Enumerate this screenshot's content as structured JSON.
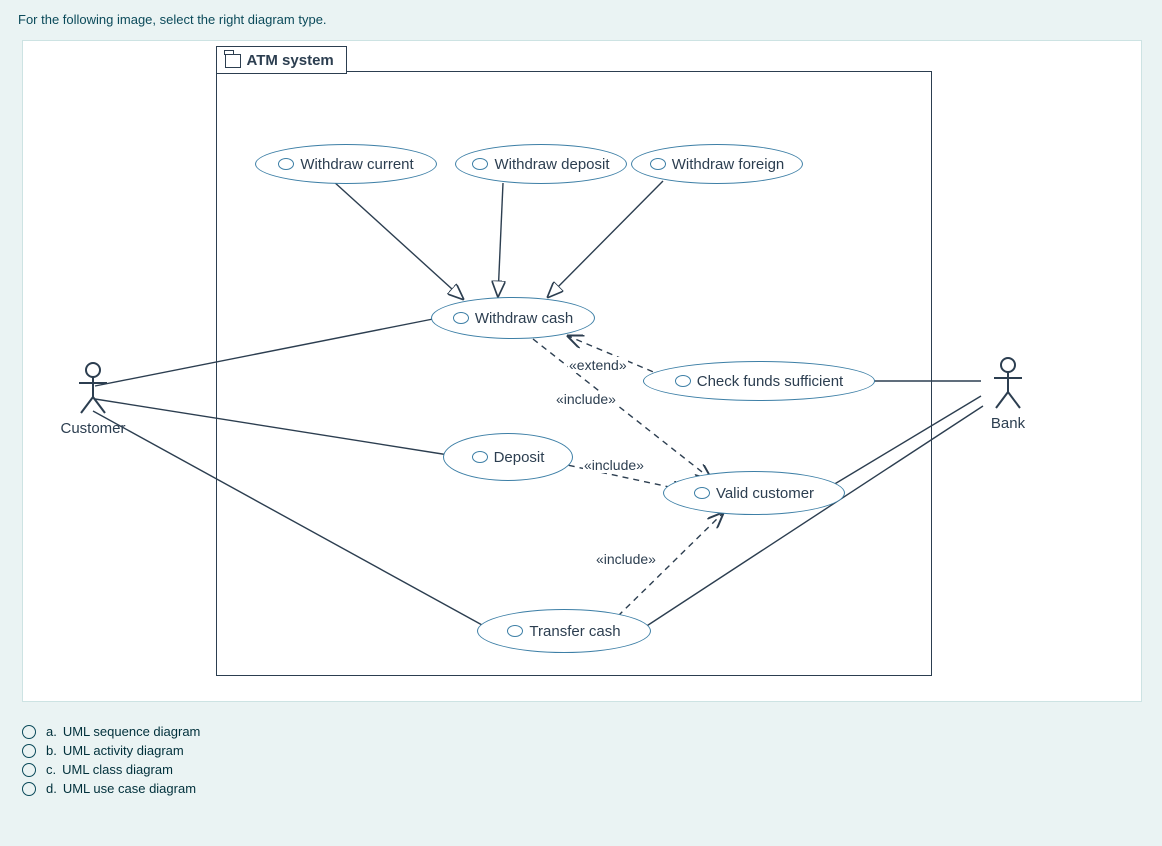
{
  "question": "For the following image, select the right diagram type.",
  "system": {
    "title": "ATM system"
  },
  "actors": {
    "customer": "Customer",
    "bank": "Bank"
  },
  "usecases": {
    "withdraw_current": "Withdraw current",
    "withdraw_deposit": "Withdraw deposit",
    "withdraw_foreign": "Withdraw foreign",
    "withdraw_cash": "Withdraw cash",
    "check_funds": "Check funds sufficient",
    "deposit": "Deposit",
    "valid_customer": "Valid customer",
    "transfer_cash": "Transfer cash"
  },
  "stereotypes": {
    "extend": "«extend»",
    "include1": "«include»",
    "include2": "«include»",
    "include3": "«include»"
  },
  "options": {
    "a": {
      "letter": "a.",
      "label": "UML sequence diagram"
    },
    "b": {
      "letter": "b.",
      "label": "UML activity diagram"
    },
    "c": {
      "letter": "c.",
      "label": "UML class diagram"
    },
    "d": {
      "letter": "d.",
      "label": "UML use case diagram"
    }
  }
}
